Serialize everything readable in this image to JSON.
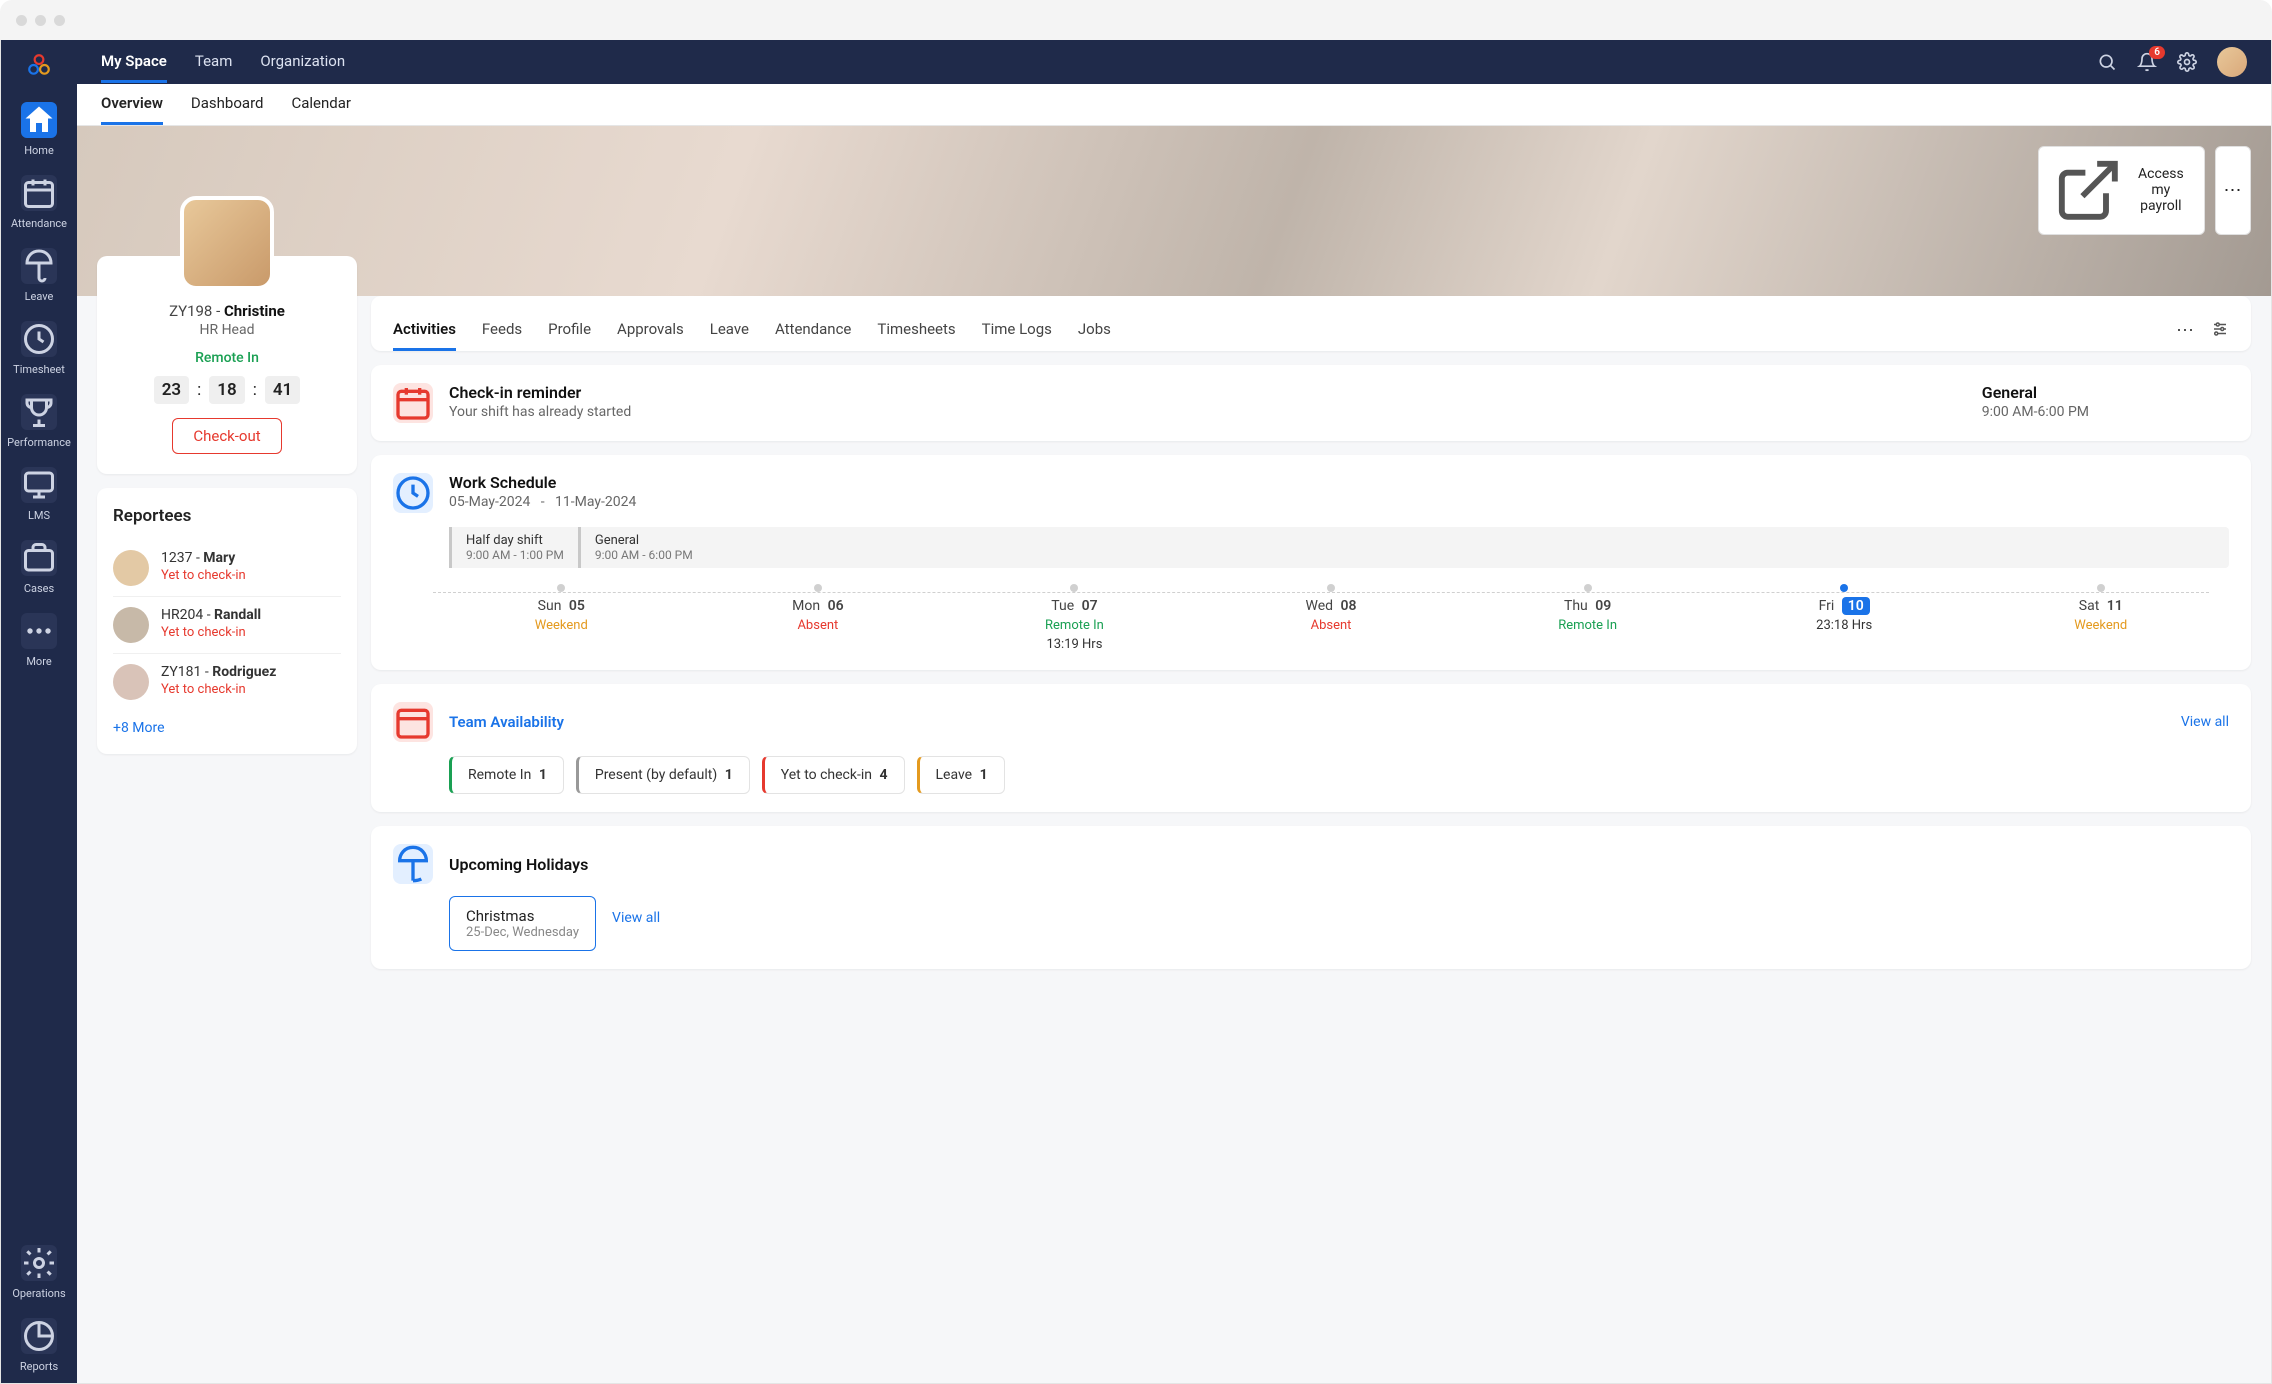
{
  "topNav": {
    "tabs": [
      "My Space",
      "Team",
      "Organization"
    ],
    "activeIndex": 0,
    "notificationCount": "6"
  },
  "subNav": {
    "tabs": [
      "Overview",
      "Dashboard",
      "Calendar"
    ],
    "activeIndex": 0
  },
  "sidebar": {
    "items": [
      {
        "label": "Home",
        "icon": "home",
        "active": true
      },
      {
        "label": "Attendance",
        "icon": "calendar"
      },
      {
        "label": "Leave",
        "icon": "umbrella"
      },
      {
        "label": "Timesheet",
        "icon": "clock"
      },
      {
        "label": "Performance",
        "icon": "trophy"
      },
      {
        "label": "LMS",
        "icon": "monitor"
      },
      {
        "label": "Cases",
        "icon": "briefcase"
      },
      {
        "label": "More",
        "icon": "dots"
      }
    ],
    "bottom": [
      {
        "label": "Operations",
        "icon": "gear"
      },
      {
        "label": "Reports",
        "icon": "chart"
      }
    ]
  },
  "banner": {
    "payrollBtn": "Access my payroll"
  },
  "profile": {
    "id": "ZY198",
    "sep": " - ",
    "name": "Christine",
    "role": "HR Head",
    "status": "Remote In",
    "time": {
      "h": "23",
      "m": "18",
      "s": "41"
    },
    "checkoutBtn": "Check-out"
  },
  "reportees": {
    "title": "Reportees",
    "items": [
      {
        "id": "1237",
        "name": "Mary",
        "status": "Yet to check-in"
      },
      {
        "id": "HR204",
        "name": "Randall",
        "status": "Yet to check-in"
      },
      {
        "id": "ZY181",
        "name": "Rodriguez",
        "status": "Yet to check-in"
      }
    ],
    "more": "+8 More"
  },
  "activityTabs": {
    "tabs": [
      "Activities",
      "Feeds",
      "Profile",
      "Approvals",
      "Leave",
      "Attendance",
      "Timesheets",
      "Time Logs",
      "Jobs"
    ],
    "activeIndex": 0
  },
  "checkin": {
    "title": "Check-in reminder",
    "sub": "Your shift has already started",
    "shiftName": "General",
    "shiftTime": "9:00 AM-6:00 PM"
  },
  "schedule": {
    "title": "Work Schedule",
    "dateRange": {
      "from": "05-May-2024",
      "sep": "-",
      "to": "11-May-2024"
    },
    "shifts": [
      {
        "name": "Half day shift",
        "time": "9:00 AM - 1:00 PM"
      },
      {
        "name": "General",
        "time": "9:00 AM - 6:00 PM"
      }
    ],
    "days": [
      {
        "dow": "Sun",
        "num": "05",
        "status": "Weekend",
        "cls": "c-weekend",
        "hrs": ""
      },
      {
        "dow": "Mon",
        "num": "06",
        "status": "Absent",
        "cls": "c-absent",
        "hrs": ""
      },
      {
        "dow": "Tue",
        "num": "07",
        "status": "Remote In",
        "cls": "c-remote",
        "hrs": "13:19 Hrs"
      },
      {
        "dow": "Wed",
        "num": "08",
        "status": "Absent",
        "cls": "c-absent",
        "hrs": ""
      },
      {
        "dow": "Thu",
        "num": "09",
        "status": "Remote In",
        "cls": "c-remote",
        "hrs": ""
      },
      {
        "dow": "Fri",
        "num": "10",
        "status": "23:18 Hrs",
        "cls": "c-normal",
        "hrs": "",
        "today": true
      },
      {
        "dow": "Sat",
        "num": "11",
        "status": "Weekend",
        "cls": "c-weekend",
        "hrs": ""
      }
    ]
  },
  "teamAvail": {
    "title": "Team Availability",
    "viewAll": "View all",
    "chips": [
      {
        "label": "Remote In",
        "count": "1",
        "cls": "chip-green"
      },
      {
        "label": "Present (by default)",
        "count": "1",
        "cls": "chip-gray"
      },
      {
        "label": "Yet to check-in",
        "count": "4",
        "cls": "chip-red"
      },
      {
        "label": "Leave",
        "count": "1",
        "cls": "chip-yellow"
      }
    ]
  },
  "holidays": {
    "title": "Upcoming Holidays",
    "viewAll": "View all",
    "item": {
      "name": "Christmas",
      "date": "25-Dec, Wednesday"
    }
  }
}
